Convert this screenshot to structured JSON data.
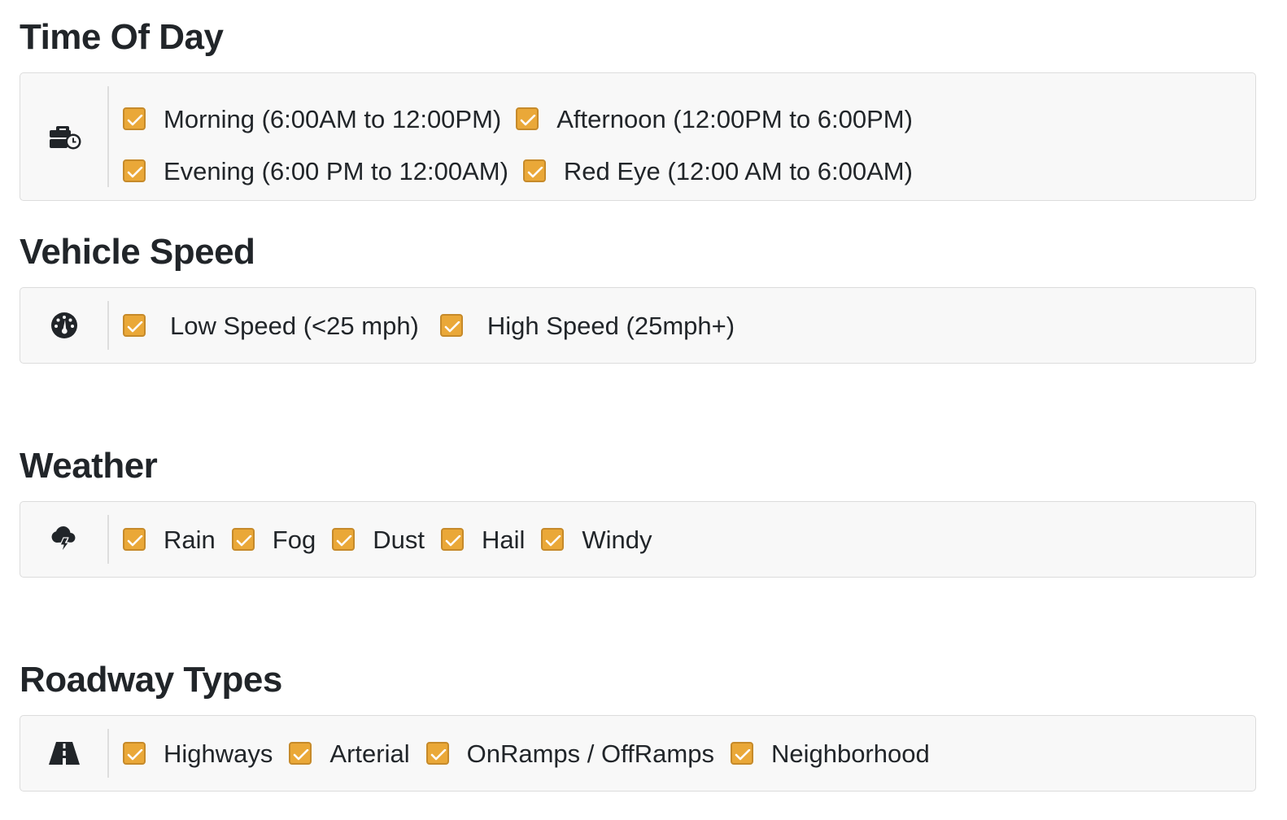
{
  "sections": {
    "time_of_day": {
      "title": "Time Of Day",
      "icon": "business-time-icon",
      "options": [
        {
          "label": "Morning (6:00AM to 12:00PM)",
          "checked": true
        },
        {
          "label": "Afternoon (12:00PM to 6:00PM)",
          "checked": true
        },
        {
          "label": "Evening (6:00 PM to 12:00AM)",
          "checked": true
        },
        {
          "label": "Red Eye (12:00 AM to 6:00AM)",
          "checked": true
        }
      ]
    },
    "vehicle_speed": {
      "title": "Vehicle Speed",
      "icon": "tachometer-icon",
      "options": [
        {
          "label": "Low Speed (<25 mph)",
          "checked": true
        },
        {
          "label": "High Speed (25mph+)",
          "checked": true
        }
      ]
    },
    "weather": {
      "title": "Weather",
      "icon": "cloud-bolt-icon",
      "options": [
        {
          "label": "Rain",
          "checked": true
        },
        {
          "label": "Fog",
          "checked": true
        },
        {
          "label": "Dust",
          "checked": true
        },
        {
          "label": "Hail",
          "checked": true
        },
        {
          "label": "Windy",
          "checked": true
        }
      ]
    },
    "roadway_types": {
      "title": "Roadway Types",
      "icon": "road-icon",
      "options": [
        {
          "label": "Highways",
          "checked": true
        },
        {
          "label": "Arterial",
          "checked": true
        },
        {
          "label": "OnRamps / OffRamps",
          "checked": true
        },
        {
          "label": "Neighborhood",
          "checked": true
        }
      ]
    }
  },
  "colors": {
    "checkbox_fill": "#eaa838",
    "checkbox_border": "#c68a2a",
    "panel_bg": "#f8f8f8",
    "panel_border": "#dcdcdc"
  }
}
